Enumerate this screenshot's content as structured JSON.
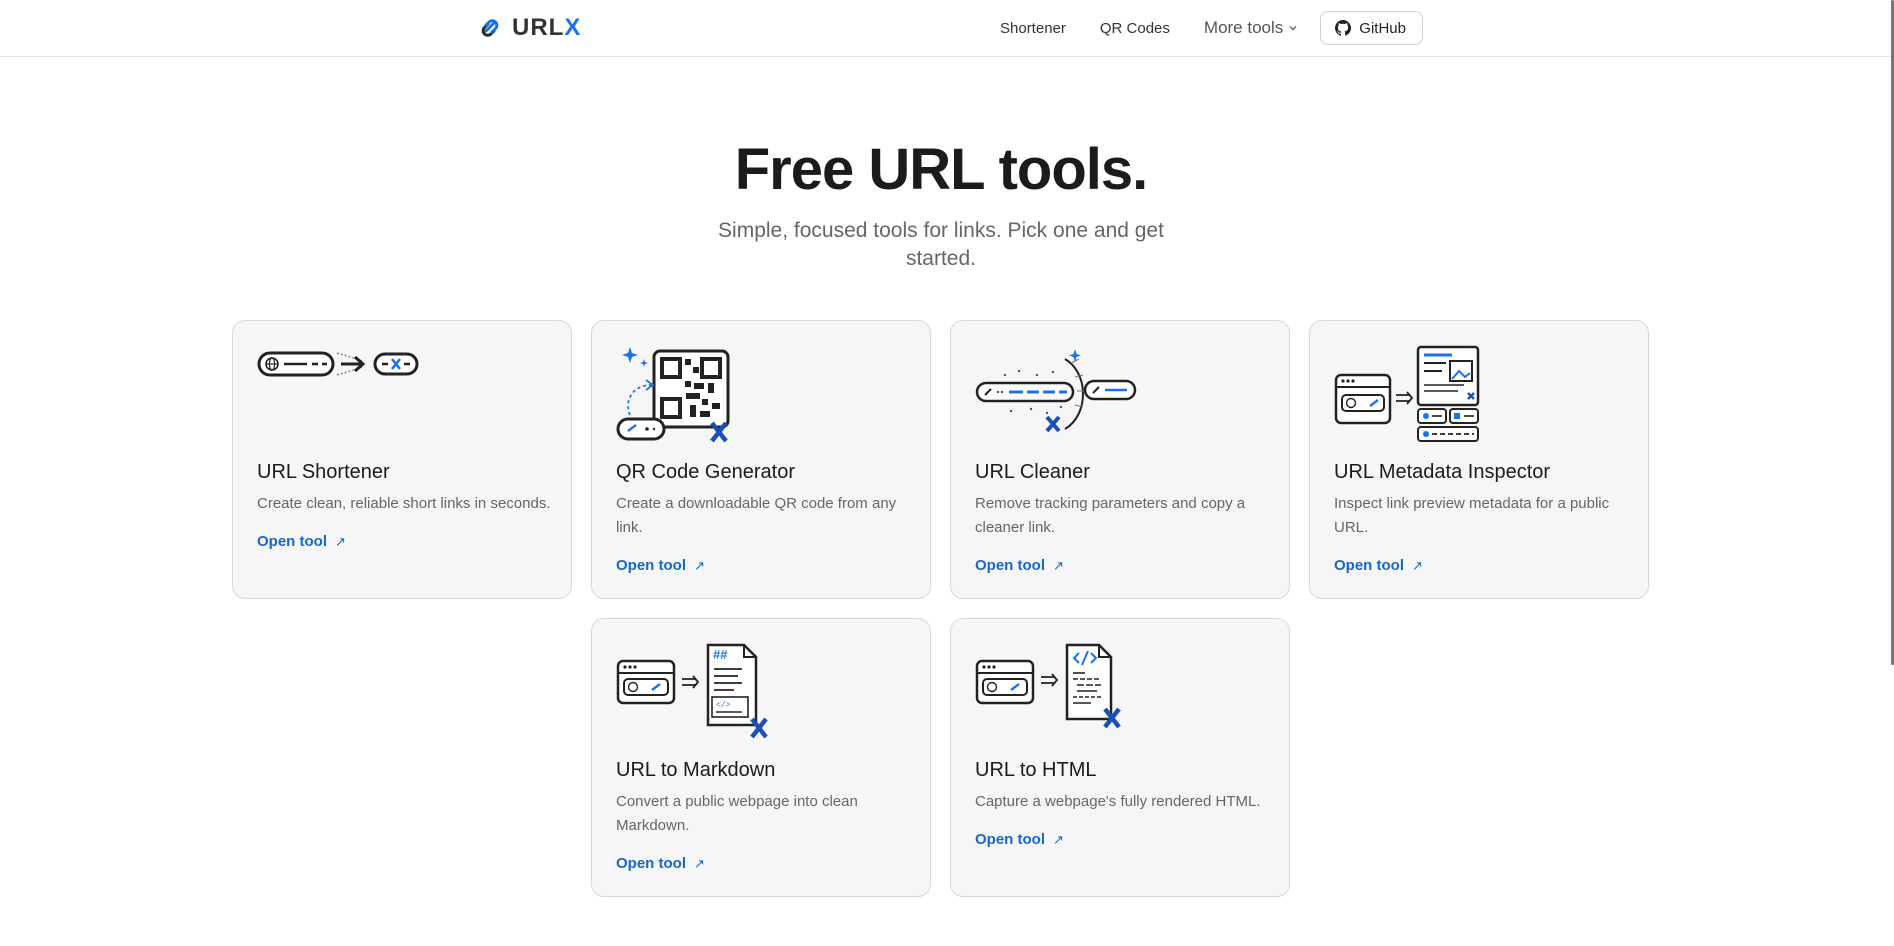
{
  "header": {
    "logo_text": "URL",
    "logo_x": "X",
    "nav": [
      {
        "label": "Shortener"
      },
      {
        "label": "QR Codes"
      }
    ],
    "more_label": "More tools",
    "github_label": "GitHub"
  },
  "hero": {
    "title": "Free URL tools.",
    "subtitle": "Simple, focused tools for links. Pick one and get started."
  },
  "tools": [
    {
      "title": "URL Shortener",
      "description": "Create clean, reliable short links in seconds.",
      "link": "Open tool"
    },
    {
      "title": "QR Code Generator",
      "description": "Create a downloadable QR code from any link.",
      "link": "Open tool"
    },
    {
      "title": "URL Cleaner",
      "description": "Remove tracking parameters and copy a cleaner link.",
      "link": "Open tool"
    },
    {
      "title": "URL Metadata Inspector",
      "description": "Inspect link preview metadata for a public URL.",
      "link": "Open tool"
    },
    {
      "title": "URL to Markdown",
      "description": "Convert a public webpage into clean Markdown.",
      "link": "Open tool"
    },
    {
      "title": "URL to HTML",
      "description": "Capture a webpage's fully rendered HTML.",
      "link": "Open tool"
    }
  ],
  "illustration_text": {
    "markdown_heading": "##",
    "html_tag": "</>",
    "brand_x": "X"
  },
  "colors": {
    "accent": "#1a73e8",
    "link": "#1668c7",
    "card_bg": "#f6f6f7",
    "card_border": "#d8d8d8"
  },
  "icons": [
    "link-logo-icon",
    "chevron-down-icon",
    "github-icon",
    "external-arrow-icon"
  ]
}
